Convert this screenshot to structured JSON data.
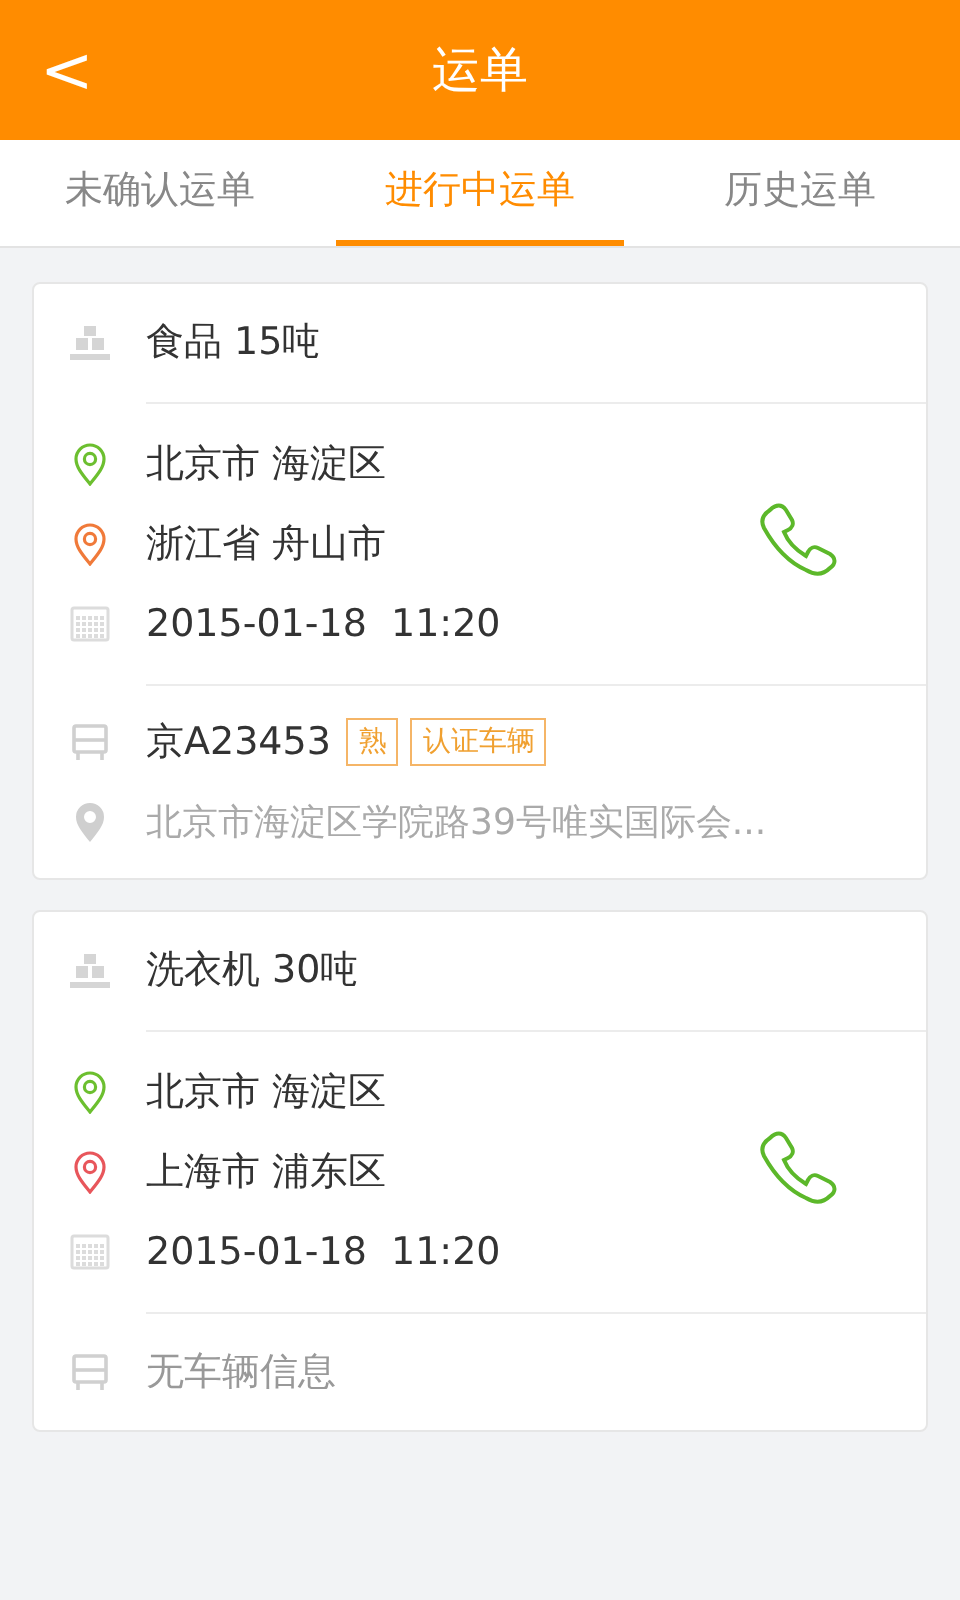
{
  "header": {
    "back": "<",
    "title": "运单"
  },
  "tabs": [
    {
      "label": "未确认运单",
      "selected": false
    },
    {
      "label": "进行中运单",
      "selected": true
    },
    {
      "label": "历史运单",
      "selected": false
    }
  ],
  "orders": [
    {
      "cargo": "食品 15吨",
      "stops": [
        {
          "place": "北京市 海淀区",
          "color": "#6cbf2f"
        },
        {
          "place": "浙江省 舟山市",
          "color": "#f07a3a"
        }
      ],
      "time": "2015-01-18  11:20",
      "vehicle": {
        "kind": "assigned",
        "plate": "京A23453",
        "tags": [
          "熟",
          "认证车辆"
        ],
        "location": "北京市海淀区学院路39号唯实国际会..."
      }
    },
    {
      "cargo": "洗衣机 30吨",
      "stops": [
        {
          "place": "北京市 海淀区",
          "color": "#6cbf2f"
        },
        {
          "place": "上海市 浦东区",
          "color": "#e8565b"
        }
      ],
      "time": "2015-01-18  11:20",
      "vehicle": {
        "kind": "none",
        "text": "无车辆信息"
      }
    }
  ]
}
